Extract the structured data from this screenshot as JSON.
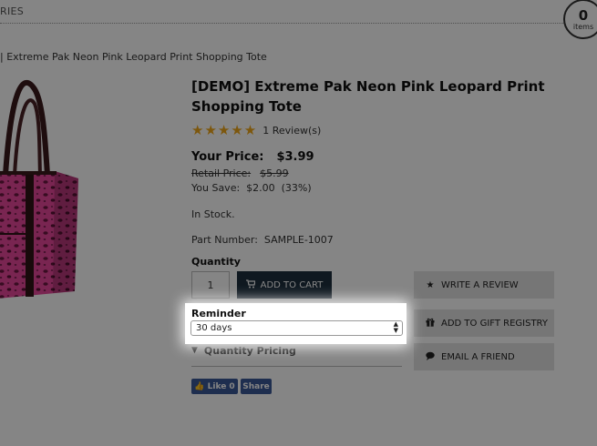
{
  "nav": {
    "label": "RIES"
  },
  "cart": {
    "count": "0",
    "label": "items"
  },
  "breadcrumb": {
    "current": "| Extreme Pak Neon Pink Leopard Print Shopping Tote"
  },
  "product": {
    "title": "[DEMO] Extreme Pak Neon Pink Leopard Print Shopping Tote",
    "rating": {
      "stars": "★★★★★",
      "reviews": "1 Review(s)"
    },
    "your_price_label": "Your Price:",
    "your_price": "$3.99",
    "retail_price_label": "Retail Price:",
    "retail_price": "$5.99",
    "you_save": "You Save:  $2.00  (33%)",
    "stock": "In Stock.",
    "part_number": "Part Number:  SAMPLE-1007"
  },
  "quantity": {
    "label": "Quantity",
    "value": "1"
  },
  "add_to_cart": {
    "icon": "cart-icon",
    "label": "ADD TO CART"
  },
  "reminder": {
    "label": "Reminder",
    "selected": "30 days"
  },
  "quantity_pricing": {
    "icon": "chevron-down-icon",
    "label": "Quantity Pricing"
  },
  "social": {
    "like_label": "Like",
    "like_count": "0",
    "share_label": "Share"
  },
  "actions": {
    "write_review": {
      "icon": "star-icon",
      "label": "WRITE A REVIEW"
    },
    "gift_registry": {
      "icon": "gift-icon",
      "label": "ADD TO GIFT REGISTRY"
    },
    "email_friend": {
      "icon": "speech-bubble-icon",
      "label": "EMAIL A FRIEND"
    }
  },
  "colors": {
    "primary_button": "#1d2f3e",
    "star": "#f0a81a",
    "facebook": "#3b5998",
    "tote_pink": "#e8479b"
  }
}
